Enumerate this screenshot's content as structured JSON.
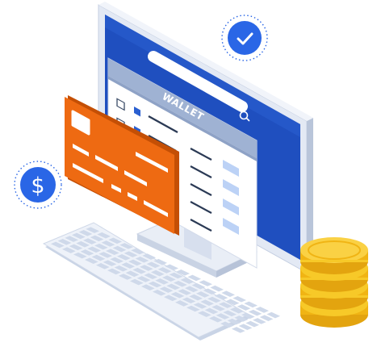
{
  "wallet_window": {
    "title": "WALLET"
  },
  "icons": {
    "check_badge": "check-icon",
    "dollar_badge": "dollar-icon",
    "search": "search-icon"
  },
  "colors": {
    "monitor_blue": "#1f4fbf",
    "monitor_frame": "#dfe6f3",
    "card_orange": "#ee6a12",
    "coin_gold": "#f5c21a",
    "badge_blue": "#2a66e6"
  }
}
